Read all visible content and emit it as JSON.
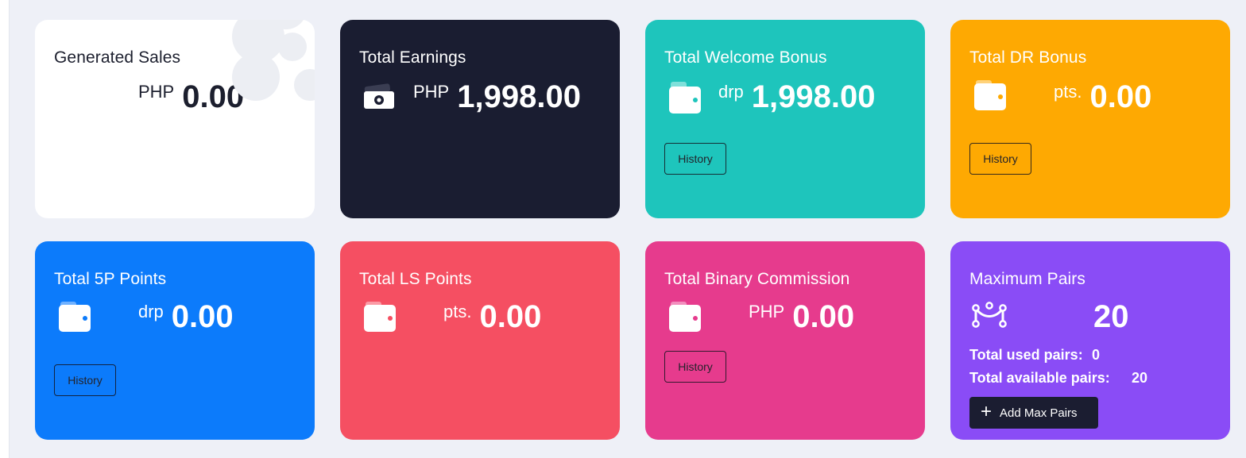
{
  "cards": {
    "generated_sales": {
      "title": "Generated Sales",
      "unit": "PHP",
      "value": "0.00"
    },
    "total_earnings": {
      "title": "Total Earnings",
      "unit": "PHP",
      "value": "1,998.00"
    },
    "welcome_bonus": {
      "title": "Total Welcome Bonus",
      "unit": "drp",
      "value": "1,998.00",
      "history_label": "History"
    },
    "dr_bonus": {
      "title": "Total DR Bonus",
      "unit": "pts.",
      "value": "0.00",
      "history_label": "History"
    },
    "fivep_points": {
      "title": "Total 5P Points",
      "unit": "drp",
      "value": "0.00",
      "history_label": "History"
    },
    "ls_points": {
      "title": "Total LS Points",
      "unit": "pts.",
      "value": "0.00"
    },
    "binary_commission": {
      "title": "Total Binary Commission",
      "unit": "PHP",
      "value": "0.00",
      "history_label": "History"
    },
    "maximum_pairs": {
      "title": "Maximum Pairs",
      "value": "20",
      "used_label": "Total used pairs:",
      "used_value": "0",
      "available_label": "Total available pairs:",
      "available_value": "20",
      "add_button_icon": "+",
      "add_button_label": "Add Max Pairs"
    }
  },
  "colors": {
    "page_bg": "#eef0f7",
    "generated_sales": "#ffffff",
    "total_earnings": "#1a1d31",
    "welcome_bonus": "#1ec5bc",
    "dr_bonus": "#fea902",
    "fivep_points": "#0c7bfb",
    "ls_points": "#f54f62",
    "binary_commission": "#e63b8d",
    "maximum_pairs": "#8a4cf6"
  },
  "icons": {
    "cash": "cash-icon",
    "wallet": "wallet-icon",
    "pairs": "pairs-network-icon",
    "plus": "plus-icon"
  }
}
